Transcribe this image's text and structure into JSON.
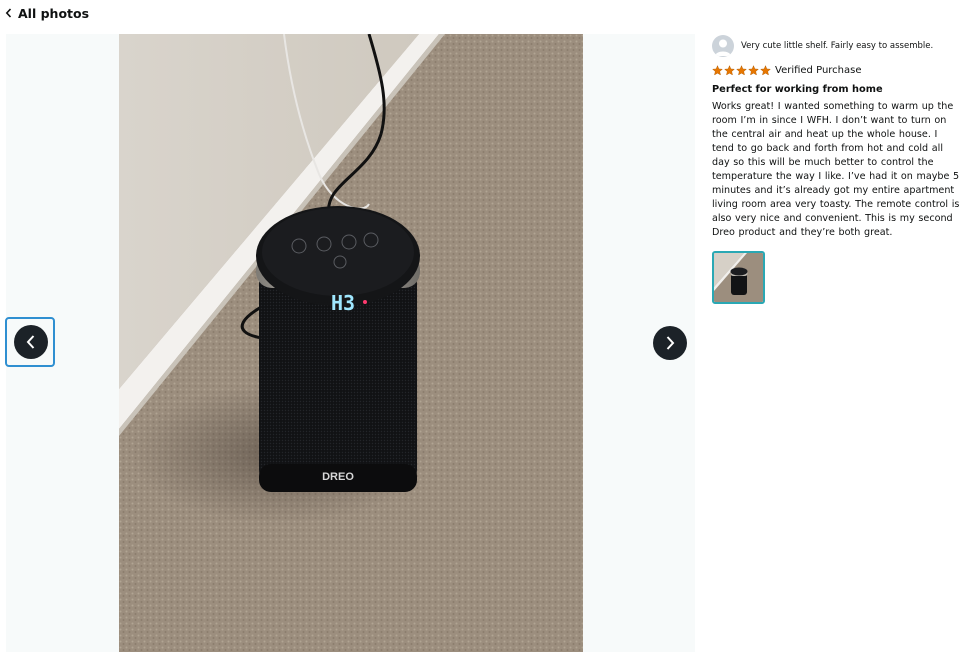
{
  "header": {
    "back_label": "All photos"
  },
  "viewer": {
    "photo_alt": "Customer photo of a black ceramic space heater on carpet",
    "product_brand_mark": "DREO",
    "heater_display": "H3",
    "prev_label": "Previous photo",
    "next_label": "Next photo"
  },
  "review": {
    "reviewer_name": "Very cute little shelf. Fairly easy to assemble.",
    "rating": 5,
    "rating_max": 5,
    "verified_label": "Verified Purchase",
    "title": "Perfect for working from home",
    "body": "Works great! I wanted something to warm up the room I’m in since I WFH. I don’t want to turn on the central air and heat up the whole house. I tend to go back and forth from hot and cold all day so this will be much better to control the temperature the way I like. I’ve had it on maybe 5 minutes and it’s already got my entire apartment living room area very toasty. The remote control is also very nice and convenient. This is my second Dreo product and they’re both great."
  },
  "colors": {
    "star": "#e77600",
    "focus_ring": "#2f8fd1",
    "thumb_border": "#2aa8b4",
    "nav_button": "#1c2228"
  },
  "icons": {
    "back": "chevron-left-icon",
    "prev": "chevron-left-icon",
    "next": "chevron-right-icon",
    "avatar": "user-avatar-icon",
    "star": "star-icon"
  }
}
